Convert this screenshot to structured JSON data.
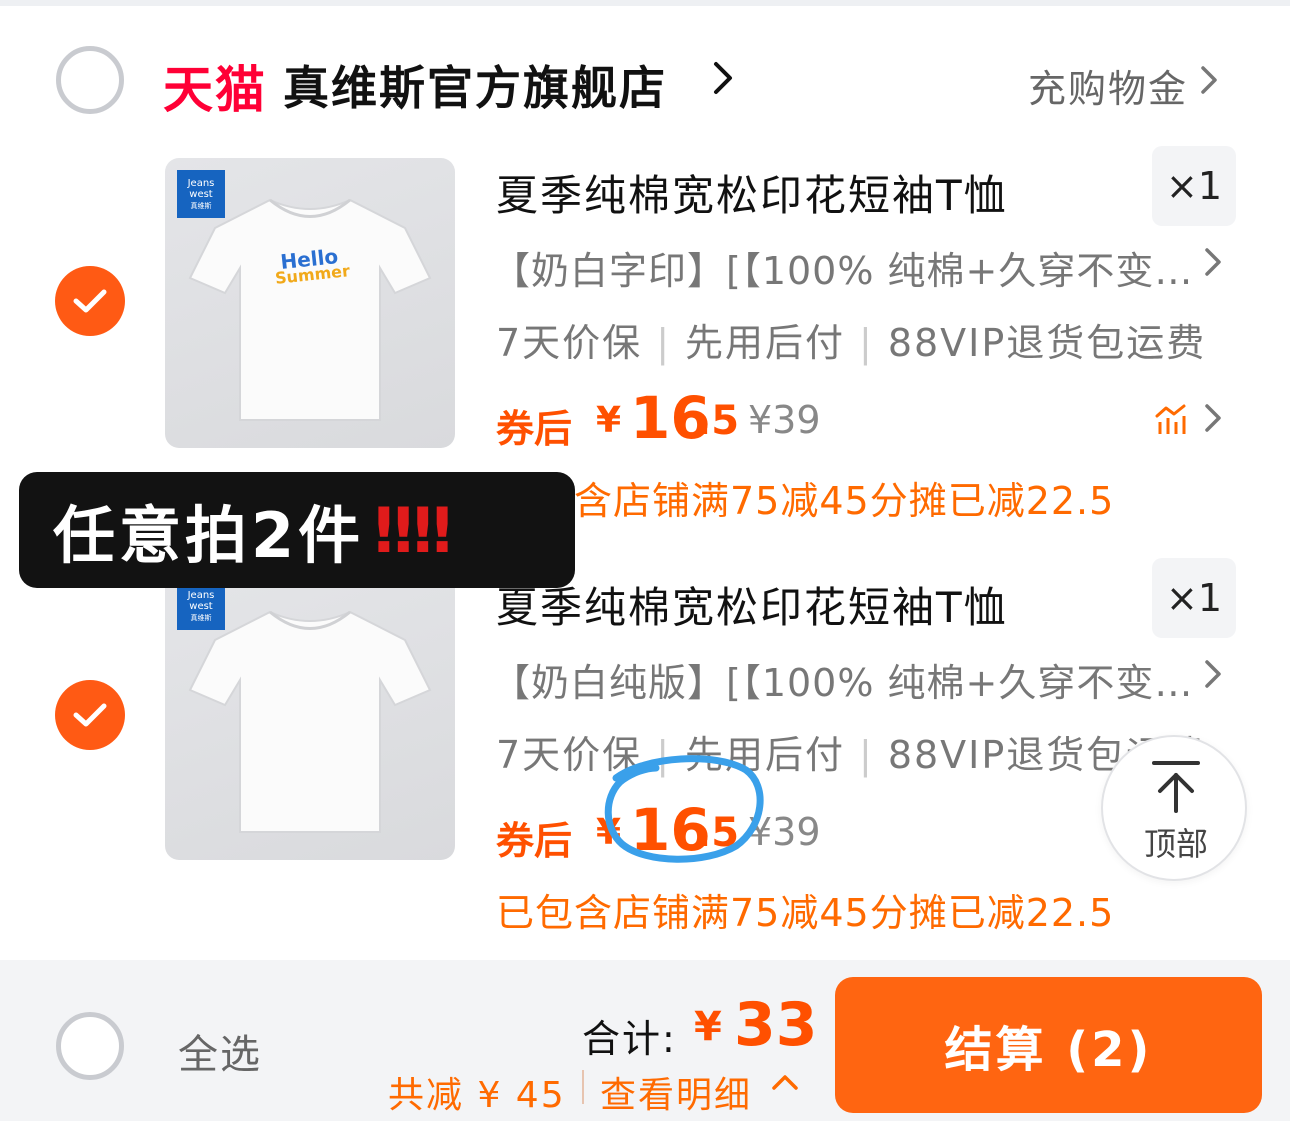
{
  "shop": {
    "platform": "天猫",
    "name": "真维斯官方旗舰店",
    "gold_label": "充购物金"
  },
  "items": [
    {
      "brand_logo": "Jeans west 真维斯",
      "shirt_print": "Hello Summer",
      "title": "夏季纯棉宽松印花短袖T恤",
      "quantity": "×1",
      "sku": "【奶白字印】[【100% 纯棉+久穿不变…",
      "services": [
        "7天价保",
        "先用后付",
        "88VIP退货包运费"
      ],
      "after_label": "券后",
      "currency": "¥",
      "price_int": "16",
      "price_dec": ".5",
      "original_price": "¥39",
      "discount_note": "已包含店铺满75减45分摊已减22.5",
      "checked": true
    },
    {
      "brand_logo": "Jeans west 真维斯",
      "shirt_print": "",
      "title": "夏季纯棉宽松印花短袖T恤",
      "quantity": "×1",
      "sku": "【奶白纯版】[【100% 纯棉+久穿不变…",
      "services": [
        "7天价保",
        "先用后付",
        "88VIP退货包运费"
      ],
      "after_label": "券后",
      "currency": "¥",
      "price_int": "16",
      "price_dec": ".5",
      "original_price": "¥39",
      "discount_note": "已包含店铺满75减45分摊已减22.5",
      "checked": true
    }
  ],
  "overlay": {
    "text": "任意拍2件",
    "emphasis": "‼‼"
  },
  "back_to_top": {
    "label": "顶部",
    "icon": "arrow-up-to-top-icon"
  },
  "footer": {
    "select_all": "全选",
    "total_label": "合计:",
    "total_currency": "¥",
    "total_value": "33",
    "saved": "共减 ¥ 45",
    "detail": "查看明细",
    "checkout": "结算 (2)"
  },
  "colors": {
    "accent": "#ff5000",
    "tmall_red": "#ff0036",
    "checkout_bg": "#ff6511",
    "annotation_circle": "#3aa0ea"
  }
}
